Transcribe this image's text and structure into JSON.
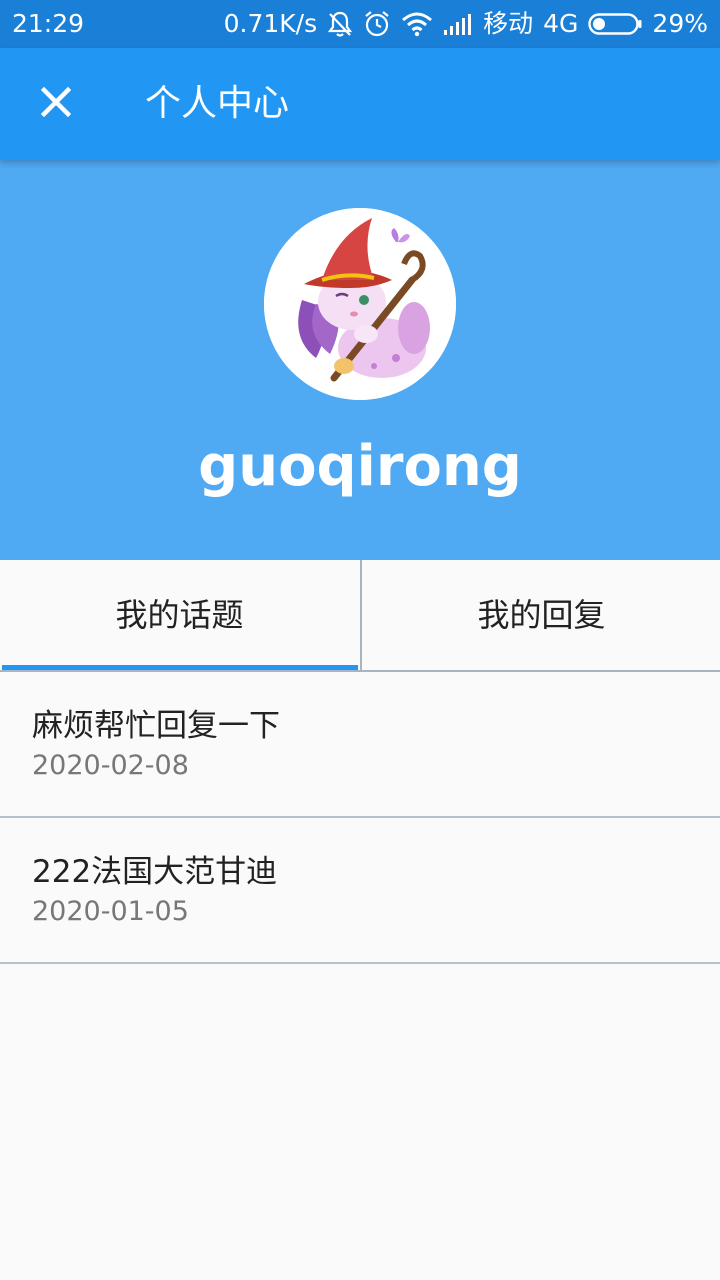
{
  "status_bar": {
    "time": "21:29",
    "net_speed": "0.71K/s",
    "carrier": "移动",
    "network": "4G",
    "battery": "29%",
    "battery_level": 0.29,
    "icons": [
      "mute-bell-icon",
      "alarm-icon",
      "wifi-icon",
      "signal-icon",
      "battery-icon"
    ]
  },
  "app_bar": {
    "close_icon": "close-icon",
    "title": "个人中心"
  },
  "profile": {
    "avatar": "avatar-image",
    "username": "guoqirong"
  },
  "tabs": [
    {
      "label": "我的话题",
      "selected": true
    },
    {
      "label": "我的回复",
      "selected": false
    }
  ],
  "topics": [
    {
      "title": "麻烦帮忙回复一下",
      "date": "2020-02-08"
    },
    {
      "title": "222法国大范甘迪",
      "date": "2020-01-05"
    }
  ],
  "colors": {
    "status_bar": "#1a7fd6",
    "app_bar": "#2196f3",
    "profile_bg": "#4fa9f3",
    "tab_indicator": "#2196f3"
  }
}
